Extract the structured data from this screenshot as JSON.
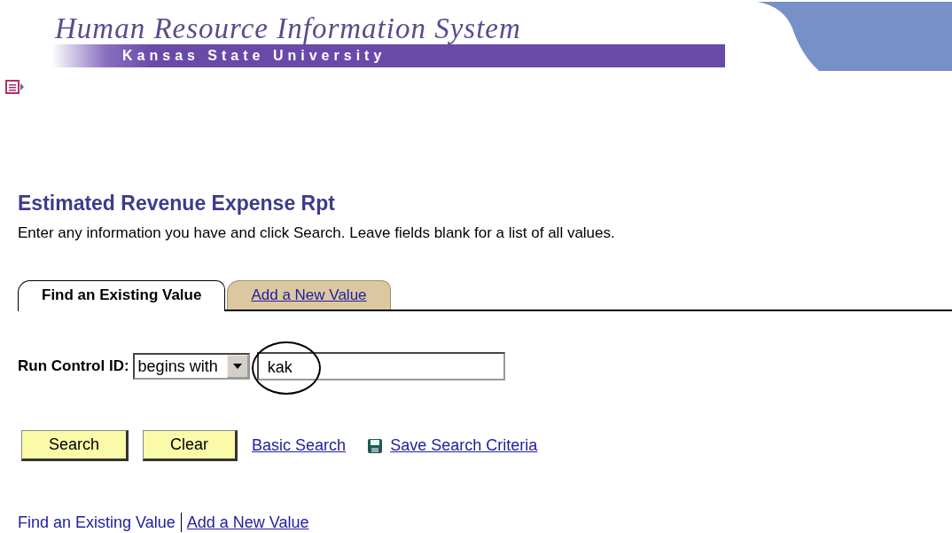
{
  "header": {
    "title": "Human Resource Information System",
    "subtitle": "Kansas State University"
  },
  "page": {
    "title": "Estimated Revenue Expense Rpt",
    "instructions": "Enter any information you have and click Search. Leave fields blank for a list of all values."
  },
  "tabs": [
    {
      "label": "Find an Existing Value",
      "selected": true
    },
    {
      "label": "Add a New Value",
      "selected": false
    }
  ],
  "search": {
    "label": "Run Control ID:",
    "operator": "begins with",
    "value": "kak"
  },
  "buttons": [
    "Search",
    "Clear"
  ],
  "links": [
    {
      "label": "Basic Search",
      "kind": "plain"
    },
    {
      "label": "Save Search Criteria",
      "kind": "save"
    }
  ],
  "footer_links": [
    {
      "label": "Find an Existing Value",
      "linked": false
    },
    {
      "label": "Add a New Value",
      "linked": true
    }
  ]
}
